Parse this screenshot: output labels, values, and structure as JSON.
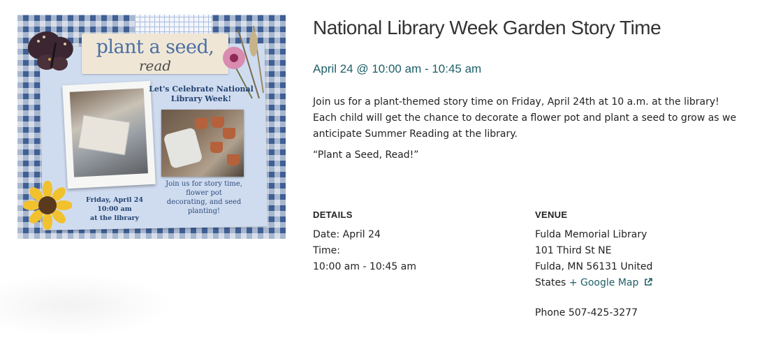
{
  "event": {
    "title": "National Library Week Garden Story Time",
    "datetime": "April 24 @ 10:00 am - 10:45 am",
    "description": "Join us for a plant-themed story time on Friday, April 24th at 10 a.m. at the library! Each child will get the chance to decorate a flower pot and plant a seed to grow as we anticipate Summer Reading at the library.",
    "quote": "“Plant a Seed, Read!”"
  },
  "image": {
    "title_line1": "plant a seed,",
    "title_line2": "read",
    "celebrate": "Let's Celebrate National Library Week!",
    "join_text": "Join us for story time, flower pot decorating, and seed planting!",
    "date_line1": "Friday, April 24",
    "date_line2": "10:00 am",
    "date_line3": "at the library"
  },
  "details": {
    "heading": "DETAILS",
    "date": "Date: April 24",
    "time_label": "Time:",
    "time_value": "10:00 am - 10:45 am"
  },
  "venue": {
    "heading": "VENUE",
    "name": "Fulda Memorial Library",
    "street": "101 Third St NE",
    "city_line": "Fulda, MN 56131 United",
    "country": "States",
    "map_link": "+ Google Map",
    "phone": "Phone 507-425-3277"
  },
  "colors": {
    "accent": "#1e6068",
    "text": "#222222"
  }
}
